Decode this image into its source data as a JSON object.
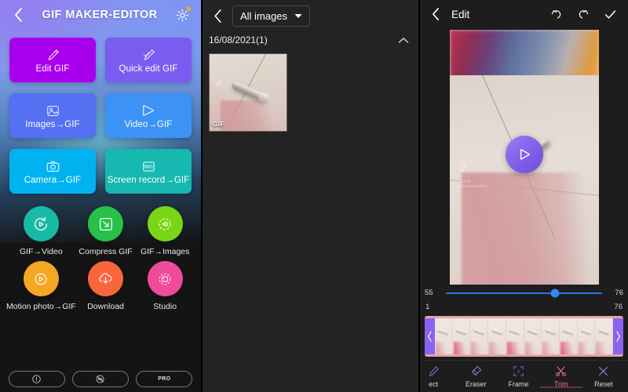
{
  "left_panel": {
    "header": {
      "title": "GIF MAKER-EDITOR",
      "back_icon": "chevron-left-icon",
      "settings_icon": "gear-icon"
    },
    "tiles": [
      {
        "label": "Edit GIF",
        "icon": "brush-icon",
        "color": "#a800ee"
      },
      {
        "label": "Quick edit GIF",
        "icon": "quick-brush-icon",
        "color": "#7a5cf0"
      },
      {
        "label": "Images→GIF",
        "icon": "image-icon",
        "color": "#5570f3"
      },
      {
        "label": "Video→GIF",
        "icon": "play-icon",
        "color": "#3d92f5"
      },
      {
        "label": "Camera→GIF",
        "icon": "camera-icon",
        "color": "#00b3f0"
      },
      {
        "label": "Screen record→GIF",
        "icon": "rec-icon",
        "color": "#16b8b0"
      }
    ],
    "circles": [
      {
        "label": "GIF→Video",
        "icon": "gif-to-video-icon",
        "color": "#19b9a6"
      },
      {
        "label": "Compress GIF",
        "icon": "compress-icon",
        "color": "#27c049"
      },
      {
        "label": "GIF→Images",
        "icon": "gif-to-images-icon",
        "color": "#7bd517"
      },
      {
        "label": "Motion photo→GIF",
        "icon": "motion-photo-icon",
        "color": "#f5a623"
      },
      {
        "label": "Download",
        "icon": "download-cloud-icon",
        "color": "#f9663c"
      },
      {
        "label": "Studio",
        "icon": "studio-icon",
        "color": "#f04a9b"
      }
    ],
    "bottom_bar": [
      {
        "label": "INFO",
        "icon": "exclamation-icon"
      },
      {
        "label": "NO ADS",
        "icon": "no-ads-icon"
      },
      {
        "label": "PRO",
        "icon": "pro-icon"
      }
    ]
  },
  "middle_panel": {
    "back_icon": "chevron-left-icon",
    "filter_label": "All images",
    "filter_caret_icon": "caret-down-icon",
    "date_group": "16/08/2021(1)",
    "collapse_icon": "chevron-up-icon",
    "thumbnails": [
      {
        "badge": "GIF",
        "alt": "safety pin on tiled floor with hand"
      }
    ]
  },
  "right_panel": {
    "header": {
      "title": "Edit",
      "back_icon": "chevron-left-icon",
      "undo_icon": "undo-icon",
      "redo_icon": "redo-icon",
      "confirm_icon": "check-icon"
    },
    "preview": {
      "play_icon": "play-circle-icon",
      "watermark": "TikTok",
      "watermark_user": "@itsmyanimation"
    },
    "slider": {
      "left_value": "55",
      "right_value": "76",
      "range_start": "1",
      "range_end": "76",
      "thumb_percent": 70,
      "track_color": "#2f72e8",
      "thumb_color": "#2f86f5"
    },
    "filmstrip": {
      "left_handle_icon": "trim-handle-left-icon",
      "right_handle_icon": "trim-handle-right-icon",
      "frame_count": 10,
      "handle_color": "#8b63f0",
      "border_color": "#e6a4a4"
    },
    "tools": [
      {
        "label": "ect",
        "icon": "effect-icon",
        "active": false
      },
      {
        "label": "Eraser",
        "icon": "eraser-icon",
        "active": false
      },
      {
        "label": "Frame",
        "icon": "frame-icon",
        "active": false
      },
      {
        "label": "Trim",
        "icon": "scissors-icon",
        "active": true
      },
      {
        "label": "Reset",
        "icon": "close-x-icon",
        "active": false
      }
    ],
    "active_tool_color": "#e8778c"
  }
}
